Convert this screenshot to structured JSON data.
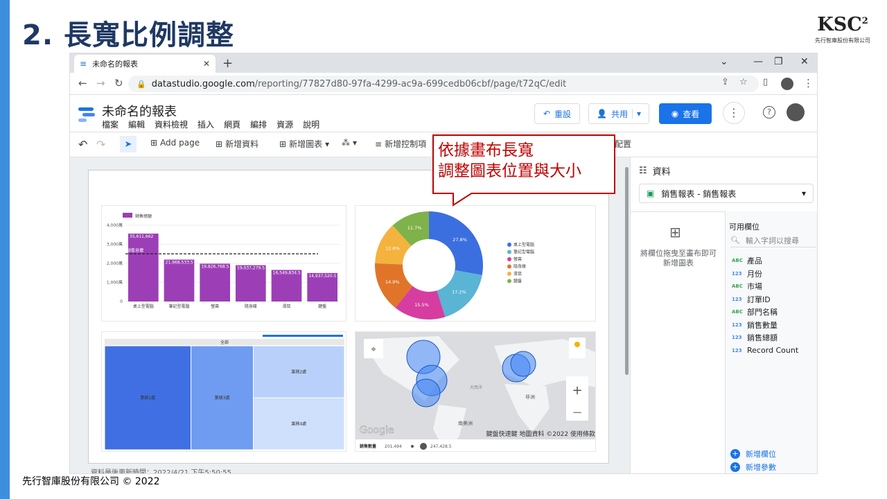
{
  "slide": {
    "title": "2. 長寬比例調整",
    "logo": "KSC",
    "logo_sup": "2",
    "logo_sub": "先行智庫股份有限公司",
    "footer": "先行智庫股份有限公司 © 2022"
  },
  "browser": {
    "tab_title": "未命名的報表",
    "url_host": "datastudio.google.com",
    "url_path": "/reporting/77827d80-97fa-4299-ac9a-699cedb06cbf/page/t72qC/edit"
  },
  "app": {
    "report_title": "未命名的報表",
    "menu": [
      "檔案",
      "編輯",
      "資料檢視",
      "插入",
      "網頁",
      "編排",
      "資源",
      "說明"
    ],
    "reset": "重設",
    "share": "共用",
    "view": "查看"
  },
  "toolbar": {
    "add_page": "Add page",
    "add_data": "新增資料",
    "add_chart": "新增圖表",
    "add_control": "新增控制項",
    "layout": "配置"
  },
  "callout": {
    "line1": "依據畫布長寬",
    "line2": "調整圖表位置與大小"
  },
  "panel": {
    "header": "資料",
    "source": "銷售報表 - 銷售報表",
    "drag_hint1": "將欄位拖曳至畫布即可",
    "drag_hint2": "新增圖表",
    "fields_title": "可用欄位",
    "search_placeholder": "輸入字詞以搜尋",
    "add_field": "新增欄位",
    "add_param": "新增參數",
    "fields": [
      {
        "type": "ABC",
        "name": "產品"
      },
      {
        "type": "123",
        "name": "月份"
      },
      {
        "type": "ABC",
        "name": "市場"
      },
      {
        "type": "123",
        "name": "訂單ID"
      },
      {
        "type": "ABC",
        "name": "部門名稱"
      },
      {
        "type": "123",
        "name": "銷售數量"
      },
      {
        "type": "123",
        "name": "銷售總額"
      },
      {
        "type": "123",
        "name": "Record Count"
      }
    ]
  },
  "status": {
    "updated": "資料最後更新時間：2022/4/21 下午5:50:55"
  },
  "chart_data": [
    {
      "type": "bar",
      "legend": "銷售總額",
      "categories": [
        "桌上型電腦",
        "筆記型電腦",
        "螢幕",
        "隨身碟",
        "滑鼠",
        "鍵盤"
      ],
      "values": [
        35611662,
        21968533.5,
        19826768.5,
        19037279.5,
        16549834.5,
        14937520.5
      ],
      "labels": [
        "35,611,662",
        "21,968,533.5",
        "19,826,768.5",
        "19,037,279.5",
        "16,549,834.5",
        "14,937,520.5"
      ],
      "yticks": [
        "4,000萬",
        "3,000萬",
        "2,000萬",
        "1,000萬",
        "0"
      ],
      "ylim": [
        0,
        40000000
      ],
      "reference_label": "銷售目標",
      "reference": 25000000
    },
    {
      "type": "pie",
      "categories": [
        "桌上型電腦",
        "筆記型電腦",
        "螢幕",
        "隨身碟",
        "滑鼠",
        "鍵盤"
      ],
      "values": [
        27.8,
        17.2,
        15.5,
        14.9,
        12.6,
        11.7
      ],
      "labels": [
        "27.8%",
        "17.2%",
        "15.5%",
        "14.9%",
        "12.6%",
        "11.7%"
      ],
      "colors": [
        "#3b6fe0",
        "#5ab4d4",
        "#d63da0",
        "#e0752a",
        "#f4b23e",
        "#7fb24a"
      ]
    },
    {
      "type": "treemap",
      "root": "全部",
      "nodes": [
        {
          "name": "業務1處",
          "value": 36
        },
        {
          "name": "業務3處",
          "value": 26
        },
        {
          "name": "業務2處",
          "value": 19
        },
        {
          "name": "業務4處",
          "value": 19
        }
      ]
    },
    {
      "type": "map",
      "legend_title": "銷售數量",
      "min": "201,494",
      "max": "247,428.5",
      "labels": [
        "非洲",
        "南美洲",
        "大西洋"
      ],
      "footer": [
        "鍵盤快速鍵",
        "地圖資料 ©2022",
        "使用條款"
      ],
      "brand": "Google"
    }
  ]
}
